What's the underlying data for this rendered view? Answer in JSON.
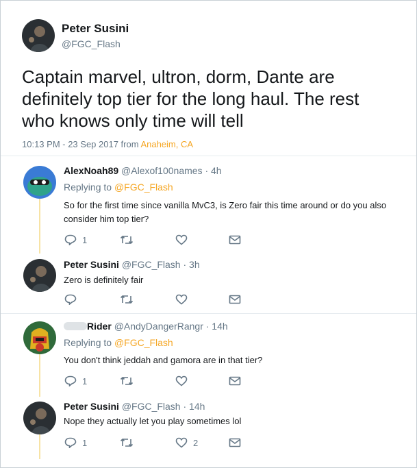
{
  "main_tweet": {
    "name": "Peter Susini",
    "handle": "@FGC_Flash",
    "text_lines": [
      "Captain marvel, ultron, dorm, Dante are",
      "definitely top tier for the long haul. The rest",
      "who knows only time will tell"
    ],
    "time": "10:13 PM - 23 Sep 2017 from ",
    "location": "Anaheim, CA"
  },
  "replies": [
    {
      "name": "AlexNoah89",
      "handle": "@Alexof100names",
      "time": "· 4h",
      "replying_prefix": "Replying to ",
      "replying_to": "@FGC_Flash",
      "text_lines": [
        "So for the first time since vanilla MvC3, is Zero fair this time around or do you also",
        "consider him top tier?"
      ],
      "reply_count": "1",
      "retweet_count": "",
      "like_count": ""
    },
    {
      "name": "Peter Susini",
      "handle": "@FGC_Flash",
      "time": "· 3h",
      "text_lines": [
        "Zero is definitely fair"
      ],
      "reply_count": "",
      "retweet_count": "",
      "like_count": ""
    },
    {
      "name": "Rider",
      "handle": "@AndyDangerRangr",
      "time": "· 14h",
      "replying_prefix": "Replying to ",
      "replying_to": "@FGC_Flash",
      "text_lines": [
        "You don't think jeddah and gamora are in that tier?"
      ],
      "reply_count": "1",
      "retweet_count": "",
      "like_count": ""
    },
    {
      "name": "Peter Susini",
      "handle": "@FGC_Flash",
      "time": "· 14h",
      "text_lines": [
        "Nope they actually let you play sometimes lol"
      ],
      "reply_count": "1",
      "retweet_count": "",
      "like_count": "2"
    }
  ],
  "colors": {
    "link": "#f5a623",
    "muted": "#657786",
    "thread_line": "#f7e3a5",
    "divider": "#e6ecf0"
  },
  "icons": [
    "reply-icon",
    "retweet-icon",
    "like-icon",
    "message-icon"
  ]
}
